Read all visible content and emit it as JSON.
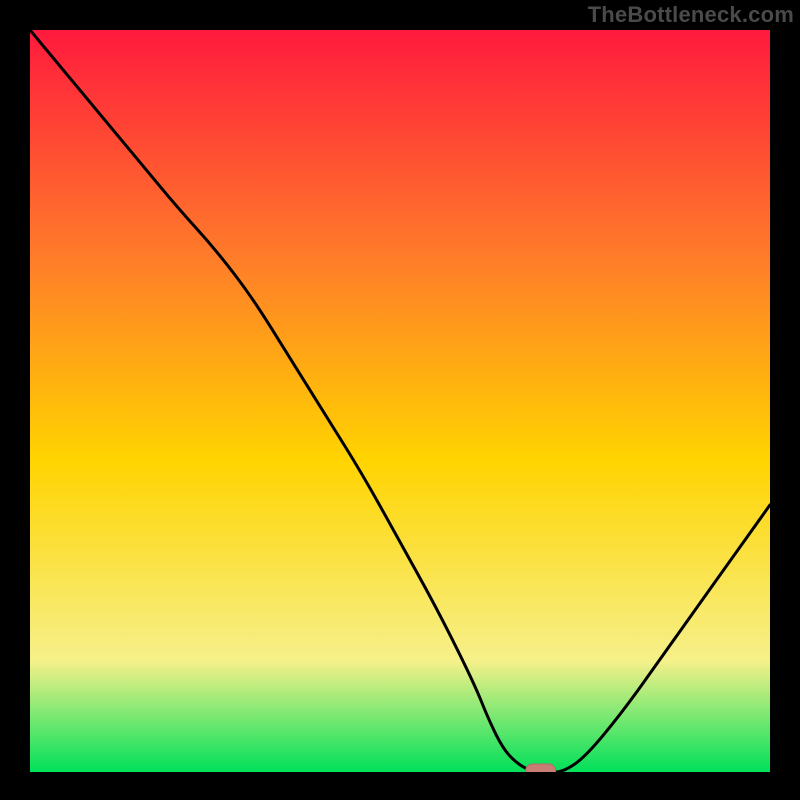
{
  "watermark": "TheBottleneck.com",
  "colors": {
    "background": "#000000",
    "gradient_top": "#ff1a3d",
    "gradient_mid1": "#ff7a2a",
    "gradient_mid2": "#ffd400",
    "gradient_mid3": "#f6f08a",
    "gradient_bottom": "#00e05a",
    "curve": "#000000",
    "marker_fill": "#c87d75",
    "marker_stroke": "#b86a62"
  },
  "chart_data": {
    "type": "line",
    "title": "",
    "xlabel": "",
    "ylabel": "",
    "xlim": [
      0,
      100
    ],
    "ylim": [
      0,
      100
    ],
    "x": [
      0,
      5,
      10,
      15,
      20,
      25,
      30,
      35,
      40,
      45,
      50,
      55,
      60,
      62,
      64,
      66,
      68,
      70,
      72,
      75,
      80,
      85,
      90,
      95,
      100
    ],
    "values": [
      100,
      94,
      88,
      82,
      76,
      70.5,
      64,
      56,
      48,
      40,
      31,
      22,
      12,
      7,
      3,
      1,
      0,
      0,
      0,
      2,
      8,
      15,
      22,
      29,
      36
    ],
    "marker": {
      "x": 69,
      "y": 0
    },
    "notes": "Values read off the vertical gradient: 100 = top (red), 0 = bottom (green). Curve starts at 100 on the left edge, descends with a slight knee near x≈25, reaches the green strip (~0) around x≈66–72, then rises roughly linearly to ~36 at the right edge."
  }
}
